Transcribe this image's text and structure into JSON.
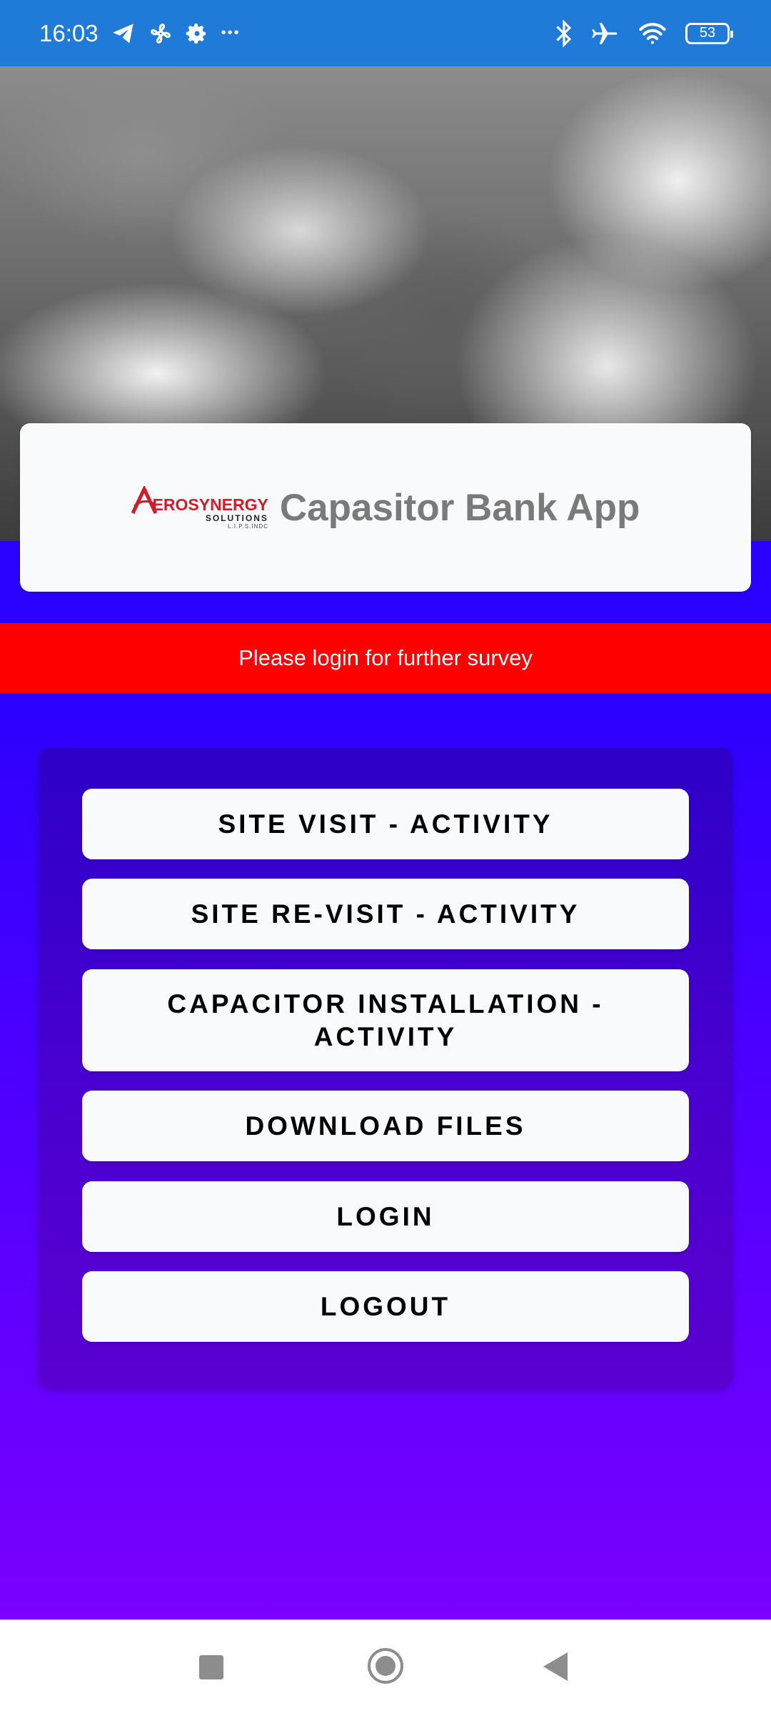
{
  "status_bar": {
    "time": "16:03",
    "left_icons": [
      "telegram-icon",
      "fan-icon",
      "settings-gear-icon",
      "more-dots-icon"
    ],
    "more_dots": "•••",
    "right_icons": [
      "bluetooth-icon",
      "airplane-mode-icon",
      "wifi-icon",
      "battery-icon"
    ],
    "battery_level": "53"
  },
  "header": {
    "logo": {
      "brand": "EROSYNERGY",
      "brand_initial": "A",
      "sub": "SOLUTIONS",
      "tiny": "L.I.P.S.INDC"
    },
    "title": "Capasitor Bank App"
  },
  "alert": {
    "text": "Please login for further survey"
  },
  "menu": {
    "buttons": [
      {
        "label": "SITE VISIT - ACTIVITY"
      },
      {
        "label": "SITE RE-VISIT - ACTIVITY"
      },
      {
        "label": "CAPACITOR INSTALLATION - ACTIVITY"
      },
      {
        "label": "DOWNLOAD FILES"
      },
      {
        "label": "LOGIN"
      },
      {
        "label": "LOGOUT"
      }
    ]
  },
  "nav_bar": {
    "icons": [
      "recents-square-icon",
      "home-circle-icon",
      "back-triangle-icon"
    ]
  },
  "colors": {
    "status_bar": "#1f7ad8",
    "alert": "#ff0000",
    "main_gradient_top": "#2c00ff",
    "main_gradient_bottom": "#7a00ff",
    "card": "#f9fafc",
    "title_text": "#7a7a7a",
    "logo_red": "#cc1f2b"
  }
}
